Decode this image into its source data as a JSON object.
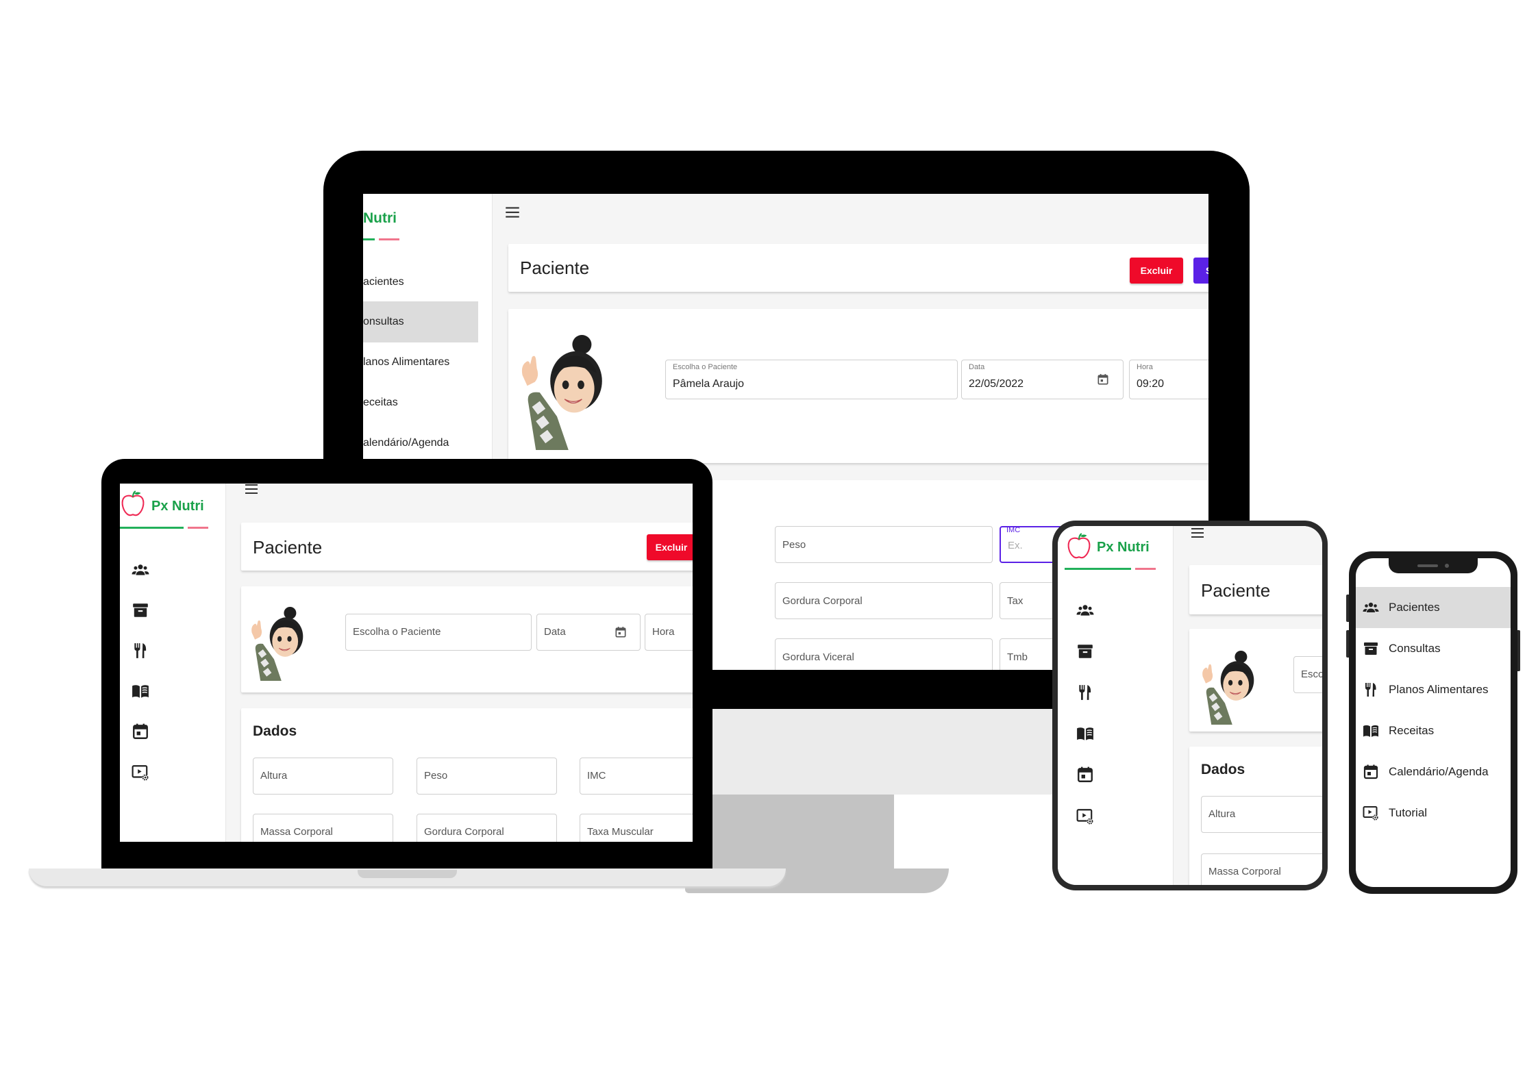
{
  "app": {
    "brand": "Px Nutri",
    "brand_partial": "Nutri"
  },
  "nav": {
    "pacientes": "Pacientes",
    "consultas": "Consultas",
    "planos": "Planos Alimentares",
    "receitas": "Receitas",
    "calendario": "Calendário/Agenda",
    "tutorial": "Tutorial",
    "pacientes_partial": "acientes",
    "consultas_partial": "onsultas",
    "planos_partial": "lanos Alimentares",
    "receitas_partial": "eceitas",
    "calendario_partial": "alendário/Agenda"
  },
  "page": {
    "title": "Paciente",
    "delete": "Excluir",
    "save_partial": "S"
  },
  "form": {
    "patient_label": "Escolha o Paciente",
    "patient_value": "Pâmela Araujo",
    "date_label": "Data",
    "date_value": "22/05/2022",
    "time_label": "Hora",
    "time_value": "09:20",
    "patient_short": "Esco"
  },
  "dados": {
    "title": "Dados",
    "altura": "Altura",
    "peso": "Peso",
    "imc": "IMC",
    "imc_placeholder": "Ex.",
    "massa": "Massa Corporal",
    "gordura": "Gordura Corporal",
    "taxa": "Taxa Muscular",
    "taxa_partial": "Tax",
    "gordura_viceral": "Gordura Viceral",
    "tmb_partial": "Tmb"
  },
  "colors": {
    "accent_red": "#ef0a2a",
    "accent_purple": "#5b21e6",
    "brand_green": "#1aa14a",
    "brand_pink": "#f0758c"
  },
  "icons": [
    "menu-icon",
    "apple-logo-icon",
    "people-icon",
    "archive-icon",
    "utensils-icon",
    "book-icon",
    "calendar-icon",
    "video-settings-icon"
  ]
}
